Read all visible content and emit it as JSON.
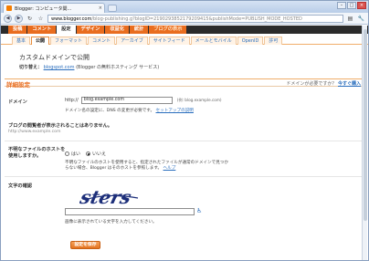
{
  "browser": {
    "tab_title": "Blogger: コンピュータ関...",
    "tab_close": "×",
    "url_host": "www.blogger.com",
    "url_rest": "/blog-publishing.g?blogID=2190293852179209415&publishMode=PUBLISH_MODE_HOSTED",
    "back": "◀",
    "forward": "▶",
    "reload": "↻",
    "star": "☆",
    "page_menu": "▤",
    "tools_menu": "🔧",
    "win_min": "–",
    "win_max": "□",
    "win_close": "×"
  },
  "blogger_tabs": [
    {
      "label": "投稿"
    },
    {
      "label": "コメント"
    },
    {
      "label": "設定"
    },
    {
      "label": "デザイン"
    },
    {
      "label": "収益化"
    },
    {
      "label": "統計"
    },
    {
      "label": "ブログの表示"
    }
  ],
  "sub_tabs": [
    {
      "label": "基本"
    },
    {
      "label": "公開"
    },
    {
      "label": "フォーマット"
    },
    {
      "label": "コメント"
    },
    {
      "label": "アーカイブ"
    },
    {
      "label": "サイトフィード"
    },
    {
      "label": "メールとモバイル"
    },
    {
      "label": "OpenID"
    },
    {
      "label": "許可"
    }
  ],
  "page": {
    "title": "カスタムドメインで公開",
    "switch_label": "切り替え：",
    "switch_link": "blogspot.com",
    "switch_suffix": " (Blogger の無料ホスティング サービス)"
  },
  "advanced": {
    "heading": "詳細設定",
    "need_domain": "ドメインが必要ですか？",
    "buy_now": "今すぐ購入"
  },
  "domain": {
    "label": "ドメイン",
    "prefix": "http://",
    "value": "blog.example.com",
    "example": "(例: blog.example.com)",
    "dns_note": "ドメイン名の設定に、DNS の変更が必要です。",
    "dns_link": "セットアップの説明",
    "redirect_label": "ブログの閲覧者が表示されることはありません。",
    "redirect_note": "http://www.example.com"
  },
  "missing": {
    "label1": "不明なファイルのホストを",
    "label2": "使用しますか。",
    "no": "はい",
    "yes": "いいえ",
    "desc1": "不明なファイルのホストを使用すると、指定されたファイルが通常のドメインで見つか",
    "desc2": "らない場合、Blogger はそのホストを参照します。",
    "help": "ヘルプ"
  },
  "captcha": {
    "label": "文字の確認",
    "word": "sters",
    "hint": "画像に表示されている文字を入力してください。"
  },
  "save_label": "設定を保存"
}
